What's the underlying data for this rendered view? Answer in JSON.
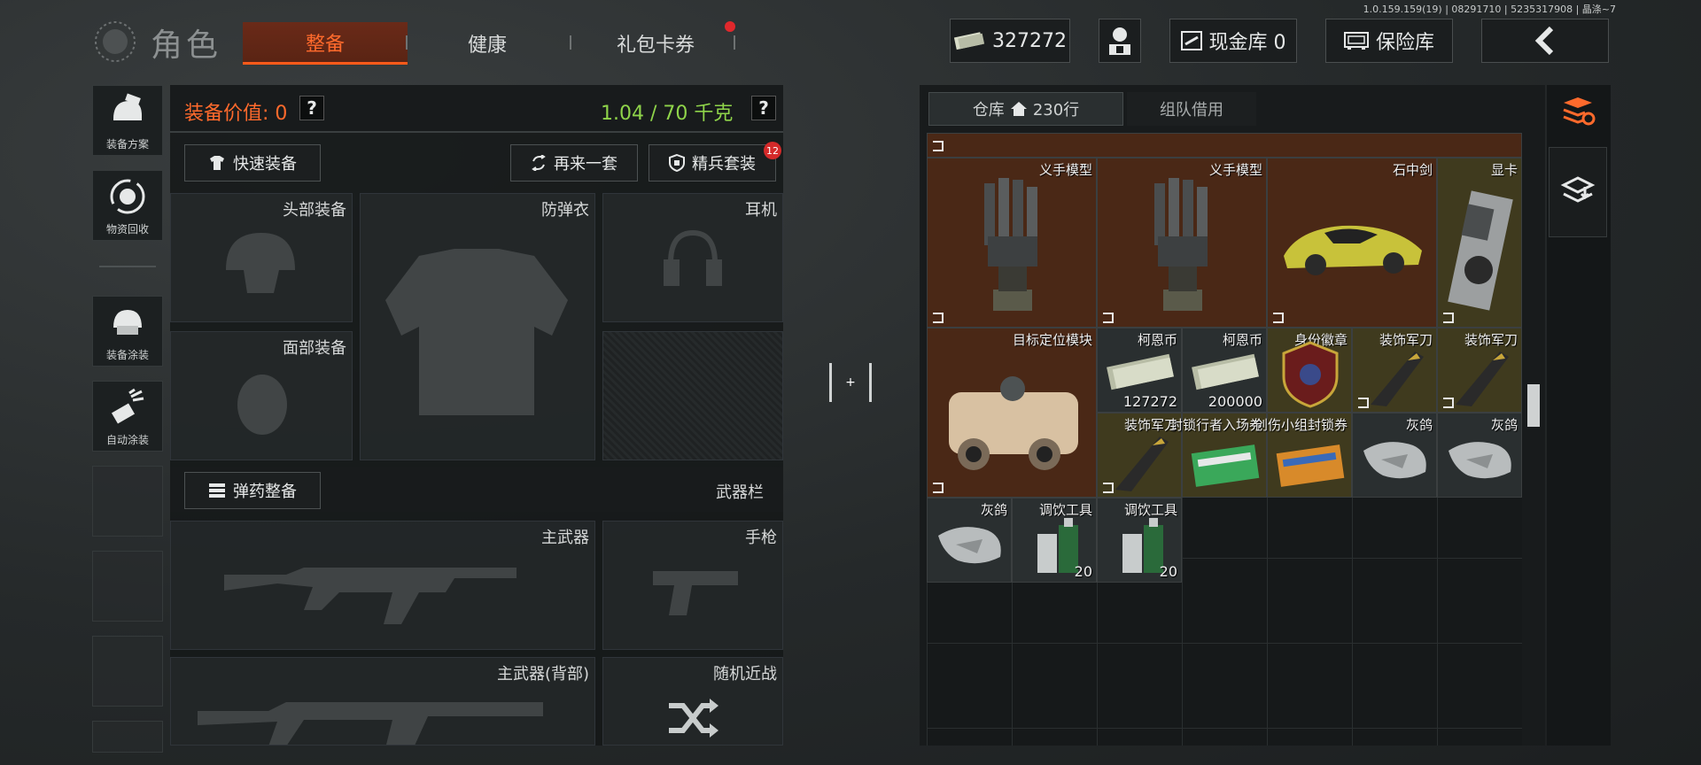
{
  "app": {
    "title": "角色",
    "version": "1.0.159.159(19) | 08291710 | 5235317908 | 晶涤~7"
  },
  "tabs": [
    {
      "label": "整备"
    },
    {
      "label": "健康"
    },
    {
      "label": "礼包卡券"
    }
  ],
  "topbar": {
    "currency": "327272",
    "cash_vault": "现金库 0",
    "safe": "保险库"
  },
  "sidebar": [
    {
      "label": "装备方案",
      "icon": "helmet-plan-icon"
    },
    {
      "label": "物资回收",
      "icon": "recycle-icon"
    },
    {
      "label": "装备涂装",
      "icon": "paint-helmet-icon"
    },
    {
      "label": "自动涂装",
      "icon": "spray-icon"
    }
  ],
  "equip": {
    "value_label": "装备价值: 0",
    "weight_label": "1.04 / 70 千克",
    "help": "?",
    "quick_equip": "快速装备",
    "again": "再来一套",
    "elite": "精兵套装",
    "elite_badge": "12",
    "slots": {
      "head": "头部装备",
      "armor": "防弹衣",
      "headset": "耳机",
      "face": "面部装备",
      "ammo_btn": "弹药整备",
      "weapon_bar": "武器栏",
      "primary": "主武器",
      "pistol": "手枪",
      "primary_back": "主武器(背部)",
      "melee": "随机近战"
    }
  },
  "center": {
    "plus": "+"
  },
  "inventory": {
    "tab_warehouse": "仓库",
    "tab_rows": "230行",
    "tab_team": "组队借用",
    "items": [
      {
        "name": "义手模型",
        "kind": "hand",
        "color": "orange"
      },
      {
        "name": "义手模型",
        "kind": "hand",
        "color": "orange"
      },
      {
        "name": "石中剑",
        "kind": "car",
        "color": "orange"
      },
      {
        "name": "显卡",
        "kind": "gpu",
        "color": "yellow"
      },
      {
        "name": "目标定位模块",
        "kind": "scope",
        "color": "orange"
      },
      {
        "name": "柯恩币",
        "kind": "money",
        "color": "gray",
        "qty": "127272"
      },
      {
        "name": "柯恩币",
        "kind": "money",
        "color": "gray",
        "qty": "200000"
      },
      {
        "name": "身份徽章",
        "kind": "badge",
        "color": "yellow"
      },
      {
        "name": "装饰军刀",
        "kind": "knife",
        "color": "yellow"
      },
      {
        "name": "装饰军刀",
        "kind": "knife",
        "color": "yellow"
      },
      {
        "name": "装饰军刀",
        "kind": "knife",
        "color": "yellow"
      },
      {
        "name": "封锁行者入场券",
        "kind": "ticket",
        "color": "yellow"
      },
      {
        "name": "创伤小组封锁券",
        "kind": "ticket2",
        "color": "yellow"
      },
      {
        "name": "灰鸽",
        "kind": "bird",
        "color": "gray"
      },
      {
        "name": "灰鸽",
        "kind": "bird",
        "color": "gray"
      },
      {
        "name": "灰鸽",
        "kind": "bird",
        "color": "gray"
      },
      {
        "name": "调饮工具",
        "kind": "bottles",
        "color": "gray",
        "qty": "20"
      },
      {
        "name": "调饮工具",
        "kind": "bottles",
        "color": "gray",
        "qty": "20"
      }
    ]
  },
  "colors": {
    "accent": "#ff6a2c",
    "weight": "#8fd44a",
    "orange_item": "#4a2816",
    "yellow_item": "#3f3a1e"
  }
}
